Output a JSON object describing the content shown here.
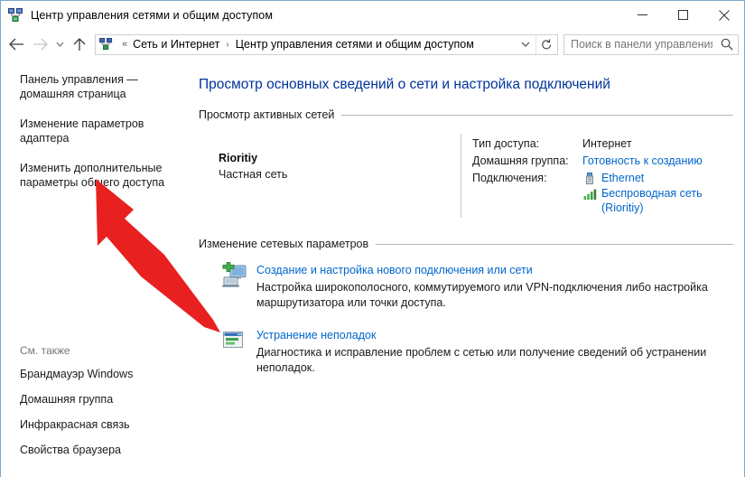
{
  "window": {
    "title": "Центр управления сетями и общим доступом",
    "icon": "network-sharing-icon",
    "minimize_label": "—",
    "maximize_label": "❐",
    "close_label": "✕"
  },
  "navbar": {
    "back_label": "←",
    "forward_label": "→",
    "history_label": "⌄",
    "up_label": "↑",
    "breadcrumb_icon": "network-sharing-icon",
    "breadcrumb_prefix": "«",
    "breadcrumb": [
      "Сеть и Интернет",
      "Центр управления сетями и общим доступом"
    ],
    "breadcrumb_separator": "›",
    "dropdown_label": "⌄",
    "refresh_label": "↻"
  },
  "search": {
    "placeholder": "Поиск в панели управления",
    "value": "",
    "icon": "search-icon"
  },
  "sidebar": {
    "items": [
      {
        "label": "Панель управления — домашняя страница"
      },
      {
        "label": "Изменение параметров адаптера"
      },
      {
        "label": "Изменить дополнительные параметры общего доступа"
      }
    ],
    "see_also_title": "См. также",
    "see_also": [
      {
        "label": "Брандмауэр Windows"
      },
      {
        "label": "Домашняя группа"
      },
      {
        "label": "Инфракрасная связь"
      },
      {
        "label": "Свойства браузера"
      }
    ]
  },
  "main": {
    "page_title": "Просмотр основных сведений о сети и настройка подключений",
    "active_networks": {
      "section_label": "Просмотр активных сетей",
      "network_name": "Rioritiy",
      "network_type": "Частная сеть",
      "details": [
        {
          "label": "Тип доступа:",
          "value": "Интернет",
          "is_link": false
        },
        {
          "label": "Домашняя группа:",
          "value": "Готовность к созданию",
          "is_link": true
        }
      ],
      "connections_label": "Подключения:",
      "connections": [
        {
          "name": "Ethernet",
          "icon": "ethernet-icon"
        },
        {
          "name": "Беспроводная сеть (Rioritiy)",
          "icon": "wireless-signal-icon"
        }
      ]
    },
    "change_settings": {
      "section_label": "Изменение сетевых параметров",
      "tasks": [
        {
          "icon": "new-connection-icon",
          "link": "Создание и настройка нового подключения или сети",
          "description": "Настройка широкополосного, коммутируемого или VPN-подключения либо настройка маршрутизатора или точки доступа."
        },
        {
          "icon": "troubleshoot-icon",
          "link": "Устранение неполадок",
          "description": "Диагностика и исправление проблем с сетью или получение сведений об устранении неполадок."
        }
      ]
    }
  },
  "annotation": {
    "arrow": "red-arrow-pointing-to-advanced-sharing-settings",
    "color": "#e8201f"
  },
  "colors": {
    "link": "#0066cc",
    "page_title": "#003399",
    "window_border": "#7aa7c7",
    "rule": "#b8b8b8",
    "muted_text": "#767676"
  }
}
